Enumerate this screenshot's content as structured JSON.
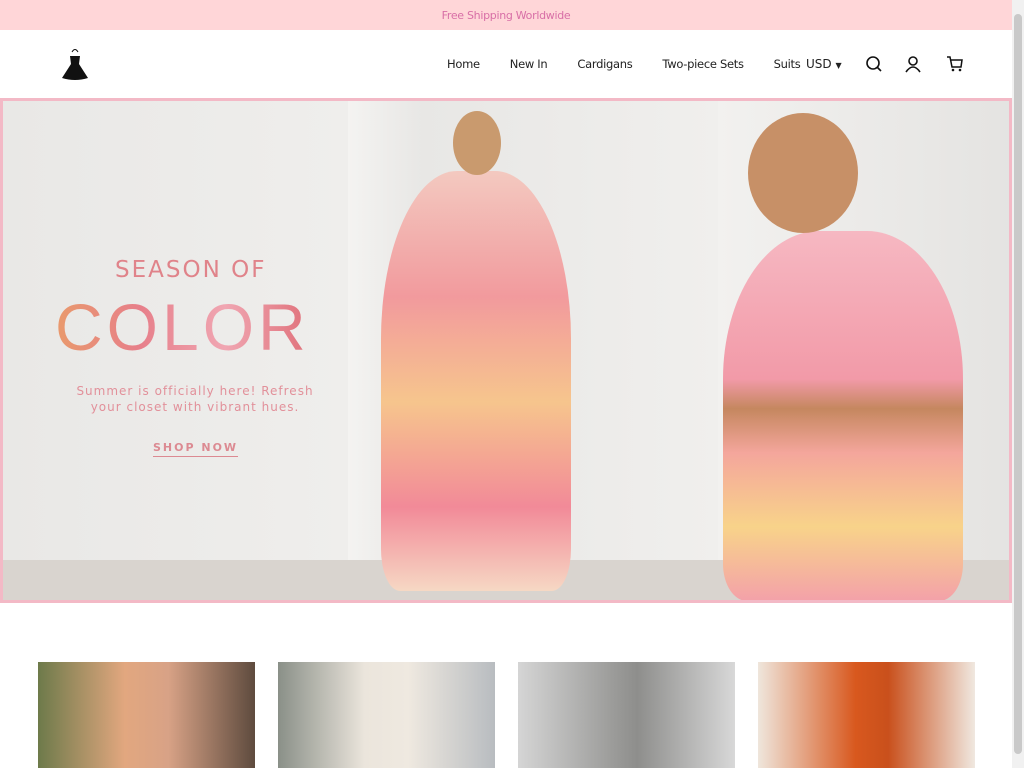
{
  "announcement": "Free Shipping Worldwide",
  "nav": {
    "items": [
      "Home",
      "New In",
      "Cardigans",
      "Two-piece Sets",
      "Suits"
    ],
    "currency": "USD"
  },
  "hero": {
    "heading_small": "SEASON OF",
    "heading_large": "COLOR",
    "subtitle": "Summer is officially here! Refresh your closet with vibrant hues.",
    "cta": "SHOP NOW"
  },
  "colors": {
    "announcement_bg": "#ffd6d8",
    "accent": "#e0838a",
    "hero_border": "#f3b9c6"
  },
  "products": [
    {
      "theme": "floral-cardigan"
    },
    {
      "theme": "two-piece-set"
    },
    {
      "theme": "grey-knit"
    },
    {
      "theme": "orange-sweater"
    }
  ]
}
